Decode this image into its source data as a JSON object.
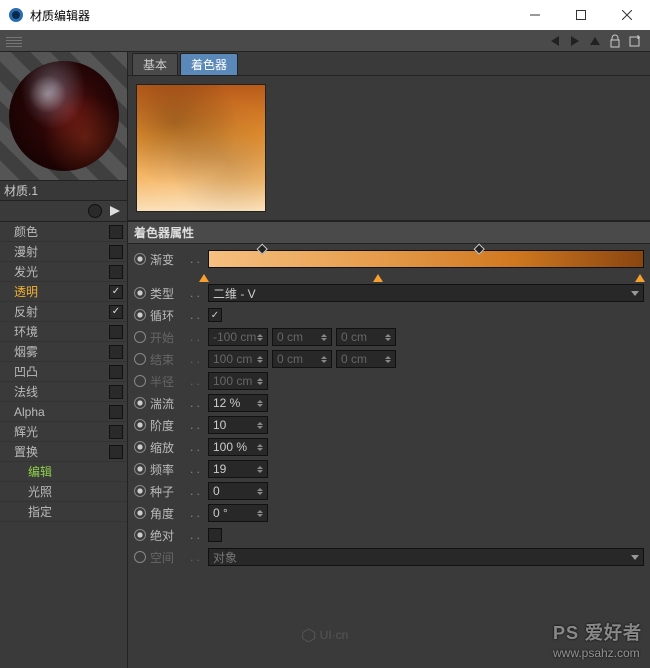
{
  "window": {
    "title": "材质编辑器"
  },
  "material": {
    "name": "材质.1"
  },
  "tabs": {
    "basic": "基本",
    "shader": "着色器"
  },
  "channels": {
    "color": "颜色",
    "diffuse": "漫射",
    "luminance": "发光",
    "transparency": "透明",
    "reflection": "反射",
    "environment": "环境",
    "fog": "烟雾",
    "bump": "凹凸",
    "normal": "法线",
    "alpha": "Alpha",
    "glow": "辉光",
    "displacement": "置换",
    "edit": "编辑",
    "illumination": "光照",
    "assignment": "指定"
  },
  "section": {
    "shader_props": "着色器属性"
  },
  "props": {
    "gradient": {
      "label": "渐变"
    },
    "type": {
      "label": "类型",
      "value": "二维 - V"
    },
    "loop": {
      "label": "循环",
      "checked": true
    },
    "start": {
      "label": "开始",
      "v0": "-100 cm",
      "v1": "0 cm",
      "v2": "0 cm"
    },
    "end": {
      "label": "结束",
      "v0": "100 cm",
      "v1": "0 cm",
      "v2": "0 cm"
    },
    "radius": {
      "label": "半径",
      "value": "100 cm"
    },
    "turb": {
      "label": "湍流",
      "value": "12 %"
    },
    "oct": {
      "label": "阶度",
      "value": "10"
    },
    "scale": {
      "label": "缩放",
      "value": "100 %"
    },
    "freq": {
      "label": "频率",
      "value": "19"
    },
    "seed": {
      "label": "种子",
      "value": "0"
    },
    "angle": {
      "label": "角度",
      "value": "0 °"
    },
    "abs": {
      "label": "绝对",
      "checked": false
    },
    "space": {
      "label": "空间",
      "value": "对象"
    }
  },
  "watermark": {
    "center": "UI·cn",
    "right1": "PS 爱好者",
    "right2": "www.psahz.com"
  }
}
